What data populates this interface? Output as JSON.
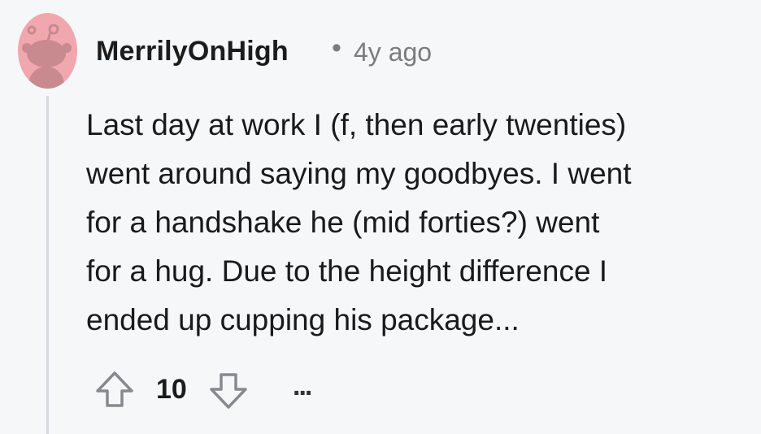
{
  "comment": {
    "author": "MerrilyOnHigh",
    "separator": "•",
    "timestamp": "4y ago",
    "body_lines": [
      "Last day at work I (f, then early twenties)",
      "went around saying my goodbyes. I went",
      "for a handshake he (mid forties?) went",
      "for a hug. Due to the height difference I",
      "ended up cupping his package..."
    ],
    "score": "10",
    "more_label": "..."
  },
  "avatar": {
    "icon": "snoo-avatar-icon",
    "bg_color": "#f1a7ae",
    "fg_color": "#c98a8f"
  },
  "icons": {
    "upvote": "arrow-up-outline-icon",
    "downvote": "arrow-down-outline-icon",
    "more": "ellipsis-icon"
  }
}
